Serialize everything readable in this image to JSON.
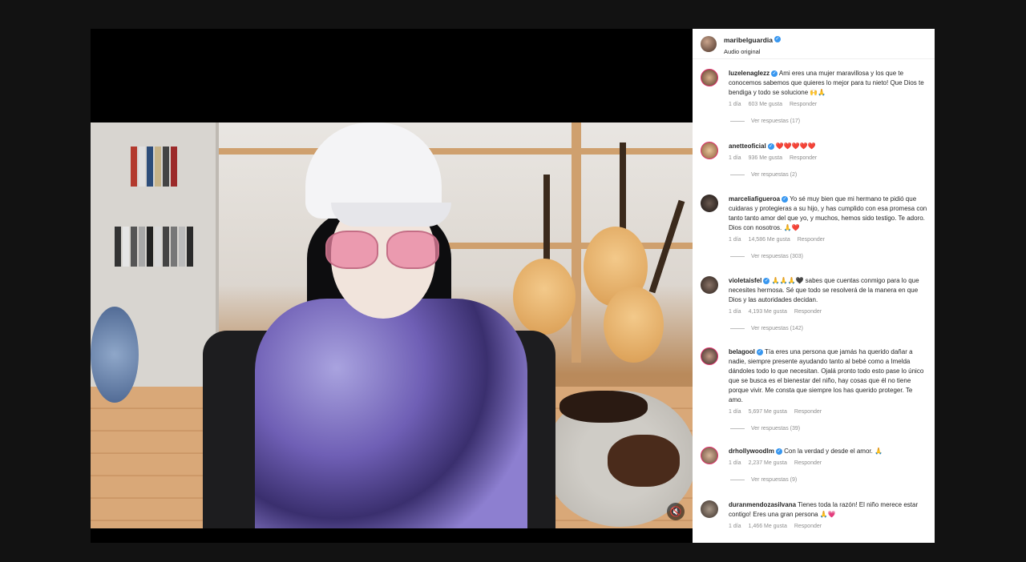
{
  "post": {
    "username": "maribelguardia",
    "audio": "Audio original"
  },
  "comments": [
    {
      "username": "luzelenaglezz",
      "text": "Ami eres una mujer maravillosa y los que te conocemos sabemos que quieres lo mejor para tu nieto! Que Dios te bendiga y todo se solucione 🙌🙏",
      "time": "1 día",
      "likes": "603 Me gusta",
      "reply": "Responder",
      "replies": "Ver respuestas (17)"
    },
    {
      "username": "anetteoficial",
      "text": "❤️❤️❤️❤️❤️",
      "time": "1 día",
      "likes": "936 Me gusta",
      "reply": "Responder",
      "replies": "Ver respuestas (2)"
    },
    {
      "username": "marceliafigueroa",
      "text": "Yo sé muy bien que mi hermano te pidió que cuidaras y protegieras a su hijo, y has cumplido con esa promesa con tanto tanto amor del que yo, y muchos, hemos sido testigo. Te adoro. Dios con nosotros. 🙏❤️",
      "time": "1 día",
      "likes": "14,586 Me gusta",
      "reply": "Responder",
      "replies": "Ver respuestas (303)"
    },
    {
      "username": "violetaisfel",
      "text": "🙏🙏🙏🖤 sabes que cuentas conmigo para lo que necesites hermosa. Sé que todo se resolverá de la manera en que Dios y las autoridades decidan.",
      "time": "1 día",
      "likes": "4,193 Me gusta",
      "reply": "Responder",
      "replies": "Ver respuestas (142)"
    },
    {
      "username": "belagool",
      "text": "Tía eres una persona que jamás ha querido dañar a nadie, siempre presente ayudando tanto al bebé como a Imelda dándoles todo lo que necesitan. Ojalá pronto todo esto pase lo único que se busca es el bienestar del niño, hay cosas que él no tiene porque vivir. Me consta que siempre los has querido proteger. Te amo.",
      "time": "1 día",
      "likes": "5,697 Me gusta",
      "reply": "Responder",
      "replies": "Ver respuestas (39)"
    },
    {
      "username": "drhollywoodlm",
      "text": "Con la verdad y desde el amor. 🙏",
      "time": "1 día",
      "likes": "2,237 Me gusta",
      "reply": "Responder",
      "replies": "Ver respuestas (9)"
    },
    {
      "username": "duranmendozasilvana",
      "text": "Tienes toda la razón! El niño merece estar contigo! Eres una gran persona 🙏💗",
      "time": "1 día",
      "likes": "1,466 Me gusta",
      "reply": "Responder",
      "replies": ""
    }
  ],
  "icons": {
    "mute": "speaker-mute-icon",
    "verified": "verified-badge-icon"
  },
  "colors": {
    "verified": "#3897f0",
    "muted_text": "#8e8e8e",
    "text": "#262626"
  }
}
